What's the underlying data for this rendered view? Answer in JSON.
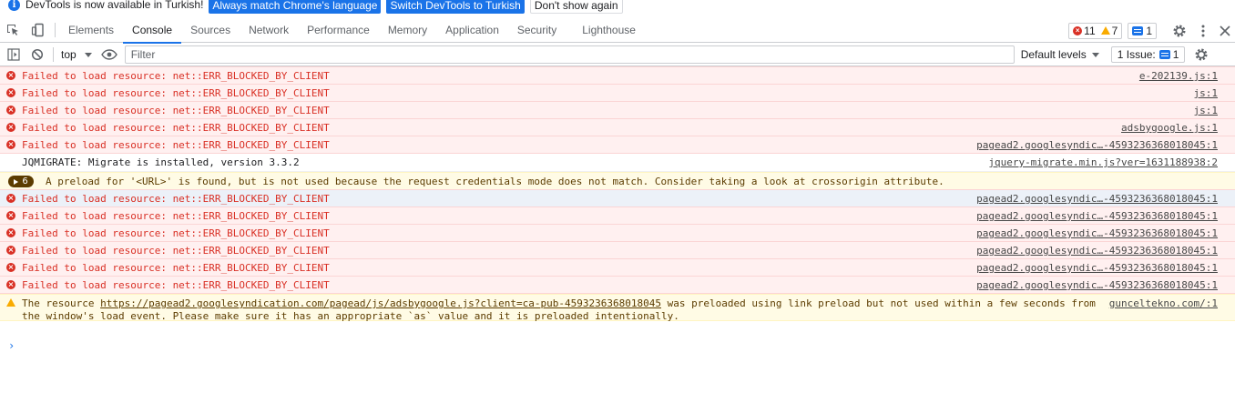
{
  "infobar": {
    "message": "DevTools is now available in Turkish!",
    "btn_match": "Always match Chrome's language",
    "btn_switch": "Switch DevTools to Turkish",
    "btn_dismiss": "Don't show again"
  },
  "tabs": [
    "Elements",
    "Console",
    "Sources",
    "Network",
    "Performance",
    "Memory",
    "Application",
    "Security",
    "Lighthouse"
  ],
  "counters": {
    "errors": "11",
    "warnings": "7",
    "messages": "1"
  },
  "toolbar": {
    "context": "top",
    "filter_placeholder": "Filter",
    "levels": "Default levels",
    "issues_label": "1 Issue:",
    "issues_count": "1"
  },
  "rows": [
    {
      "type": "error",
      "text": "Failed to load resource: net::ERR_BLOCKED_BY_CLIENT",
      "source": "e-202139.js:1"
    },
    {
      "type": "error",
      "text": "Failed to load resource: net::ERR_BLOCKED_BY_CLIENT",
      "source": "js:1"
    },
    {
      "type": "error",
      "text": "Failed to load resource: net::ERR_BLOCKED_BY_CLIENT",
      "source": "js:1"
    },
    {
      "type": "error",
      "text": "Failed to load resource: net::ERR_BLOCKED_BY_CLIENT",
      "source": "adsbygoogle.js:1"
    },
    {
      "type": "error",
      "text": "Failed to load resource: net::ERR_BLOCKED_BY_CLIENT",
      "source": "pagead2.googlesyndic…-4593236368018045:1"
    },
    {
      "type": "info",
      "text": "JQMIGRATE: Migrate is installed, version 3.3.2",
      "source": "jquery-migrate.min.js?ver=1631188938:2"
    },
    {
      "type": "warn-group",
      "count": "6",
      "text": "A preload for '<URL>' is found, but is not used because the request credentials mode does not match. Consider taking a look at crossorigin attribute."
    },
    {
      "type": "error-hl",
      "text": "Failed to load resource: net::ERR_BLOCKED_BY_CLIENT",
      "source": "pagead2.googlesyndic…-4593236368018045:1"
    },
    {
      "type": "error",
      "text": "Failed to load resource: net::ERR_BLOCKED_BY_CLIENT",
      "source": "pagead2.googlesyndic…-4593236368018045:1"
    },
    {
      "type": "error",
      "text": "Failed to load resource: net::ERR_BLOCKED_BY_CLIENT",
      "source": "pagead2.googlesyndic…-4593236368018045:1"
    },
    {
      "type": "error",
      "text": "Failed to load resource: net::ERR_BLOCKED_BY_CLIENT",
      "source": "pagead2.googlesyndic…-4593236368018045:1"
    },
    {
      "type": "error",
      "text": "Failed to load resource: net::ERR_BLOCKED_BY_CLIENT",
      "source": "pagead2.googlesyndic…-4593236368018045:1"
    },
    {
      "type": "error",
      "text": "Failed to load resource: net::ERR_BLOCKED_BY_CLIENT",
      "source": "pagead2.googlesyndic…-4593236368018045:1"
    }
  ],
  "preload_warning": {
    "prefix": "The resource ",
    "link": "https://pagead2.googlesyndication.com/pagead/js/adsbygoogle.js?client=ca-pub-4593236368018045",
    "suffix": " was preloaded using link preload but not used within a few seconds from the window's load event. Please make sure it has an appropriate `as` value and it is preloaded intentionally.",
    "source": "gunceltekno.com/:1"
  },
  "prompt": "›",
  "colors": {
    "accent": "#1a73e8",
    "error": "#d93025",
    "warning": "#f9ab00"
  }
}
